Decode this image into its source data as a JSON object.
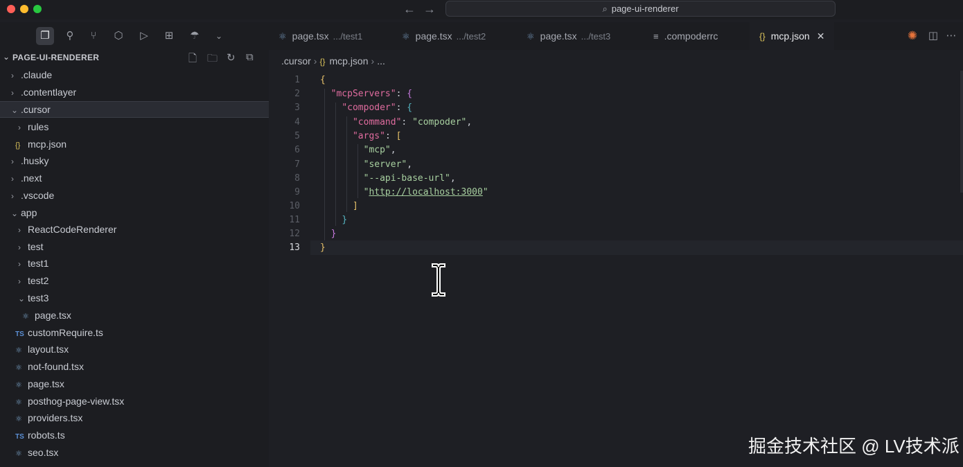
{
  "titlebar": {
    "search_text": "page-ui-renderer",
    "traffic_colors": [
      "#ff5f57",
      "#febc2e",
      "#28c840"
    ]
  },
  "tabs": [
    {
      "label": "page.tsx",
      "path": ".../test1",
      "icon": "react-icon"
    },
    {
      "label": "page.tsx",
      "path": ".../test2",
      "icon": "react-icon"
    },
    {
      "label": "page.tsx",
      "path": ".../test3",
      "icon": "react-icon"
    },
    {
      "label": ".compoderrc",
      "path": "",
      "icon": "lines-icon"
    },
    {
      "label": "mcp.json",
      "path": "",
      "icon": "json-braces-icon",
      "active": true
    }
  ],
  "sidebar": {
    "title": "PAGE-UI-RENDERER",
    "items": [
      {
        "label": ".claude",
        "type": "folder",
        "expanded": false
      },
      {
        "label": ".contentlayer",
        "type": "folder",
        "expanded": false
      },
      {
        "label": ".cursor",
        "type": "folder",
        "expanded": true,
        "selected": true
      },
      {
        "label": "rules",
        "type": "folder",
        "expanded": false
      },
      {
        "label": "mcp.json",
        "type": "json"
      },
      {
        "label": ".husky",
        "type": "folder",
        "expanded": false
      },
      {
        "label": ".next",
        "type": "folder",
        "expanded": false
      },
      {
        "label": ".vscode",
        "type": "folder",
        "expanded": false
      },
      {
        "label": "app",
        "type": "folder",
        "expanded": true
      },
      {
        "label": "ReactCodeRenderer",
        "type": "folder",
        "expanded": false
      },
      {
        "label": "test",
        "type": "folder",
        "expanded": false
      },
      {
        "label": "test1",
        "type": "folder",
        "expanded": false
      },
      {
        "label": "test2",
        "type": "folder",
        "expanded": false
      },
      {
        "label": "test3",
        "type": "folder",
        "expanded": true
      },
      {
        "label": "page.tsx",
        "type": "react"
      },
      {
        "label": "customRequire.ts",
        "type": "ts"
      },
      {
        "label": "layout.tsx",
        "type": "react"
      },
      {
        "label": "not-found.tsx",
        "type": "react"
      },
      {
        "label": "page.tsx",
        "type": "react"
      },
      {
        "label": "posthog-page-view.tsx",
        "type": "react"
      },
      {
        "label": "providers.tsx",
        "type": "react"
      },
      {
        "label": "robots.ts",
        "type": "ts"
      },
      {
        "label": "seo.tsx",
        "type": "react"
      }
    ]
  },
  "editor": {
    "breadcrumb": [
      ".cursor",
      "mcp.json",
      "..."
    ],
    "line_numbers": [
      "1",
      "2",
      "3",
      "4",
      "5",
      "6",
      "7",
      "8",
      "9",
      "10",
      "11",
      "12",
      "13"
    ],
    "current_line": "13",
    "code": {
      "mcpServers_key": "\"mcpServers\"",
      "compoder_key": "\"compoder\"",
      "command_key": "\"command\"",
      "command_val": "\"compoder\"",
      "args_key": "\"args\"",
      "arg1": "\"mcp\"",
      "arg2": "\"server\"",
      "arg3": "\"--api-base-url\"",
      "arg4_quote_open": "\"",
      "arg4_url": "http://localhost:3000",
      "arg4_quote_close": "\""
    }
  },
  "watermark": "掘金技术社区 @ LV技术派"
}
